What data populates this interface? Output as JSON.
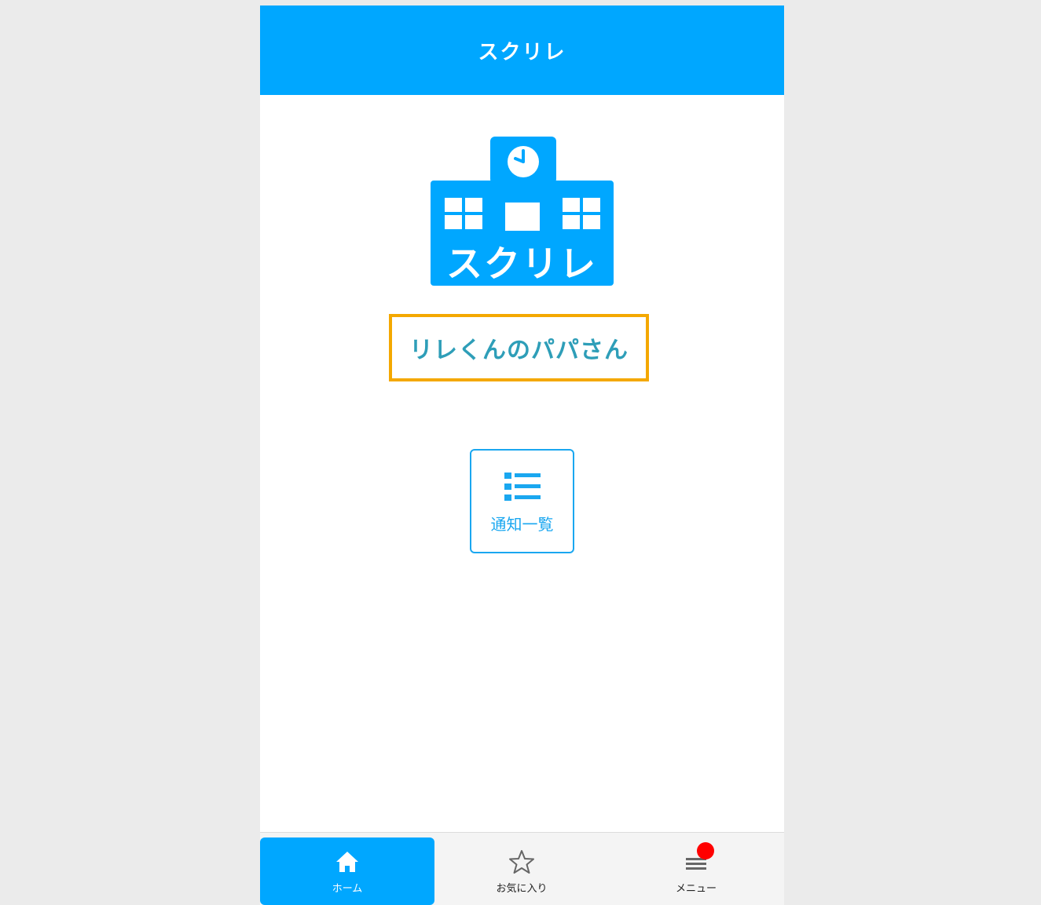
{
  "header": {
    "title": "スクリレ"
  },
  "logo": {
    "text": "スクリレ",
    "color": "#00a7ff"
  },
  "user": {
    "name": "リレくんのパパさん",
    "border_color": "#f4a800"
  },
  "actions": {
    "notifications_label": "通知一覧"
  },
  "tabbar": {
    "items": [
      {
        "label": "ホーム",
        "icon": "home-icon",
        "active": true
      },
      {
        "label": "お気に入り",
        "icon": "star-icon",
        "active": false
      },
      {
        "label": "メニュー",
        "icon": "menu-icon",
        "active": false,
        "badge": true
      }
    ]
  },
  "colors": {
    "accent": "#00a7ff",
    "badge": "#ff0000"
  }
}
